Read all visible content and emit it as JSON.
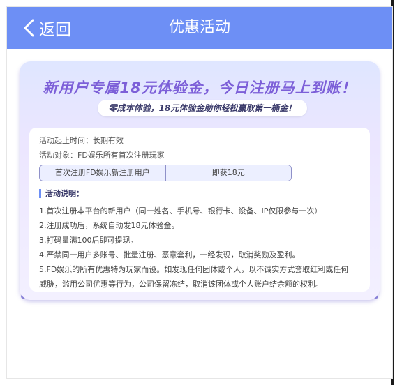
{
  "header": {
    "back_label": "返回",
    "title": "优惠活动"
  },
  "banner": {
    "headline": "新用户专属18元体验金，今日注册马上到账！",
    "subtitle": "零成本体验，18元体验金助你轻松赢取第一桶金！"
  },
  "details": {
    "period": "活动起止时间：长期有效",
    "target": "活动对象：FD娱乐所有首次注册玩家",
    "table": {
      "left": "首次注册FD娱乐新注册用户",
      "right": "即获18元"
    },
    "section_title": "活动说明：",
    "rules": [
      "1.首次注册本平台的新用户（同一姓名、手机号、银行卡、设备、IP仅限参与一次）",
      "2.注册成功后，系统自动发18元体验金。",
      "3.打码量满100后即可提现。",
      "4.严禁同一用户多账号、批量注册、恶意套利，一经发现，取消奖励及盈利。",
      "5.FD娱乐的所有优惠特为玩家而设。如发现任何团体或个人，以不诚实方式套取红利或任何",
      "威胁，滥用公司优惠等行为，公司保留冻结，取消该团体或个人账户结余额的权利。"
    ]
  },
  "colors": {
    "header": "#6d8ff5",
    "headline": "#7c5fd8",
    "border": "#8f91c9"
  },
  "icons": {
    "back": "chevron-left-icon"
  }
}
